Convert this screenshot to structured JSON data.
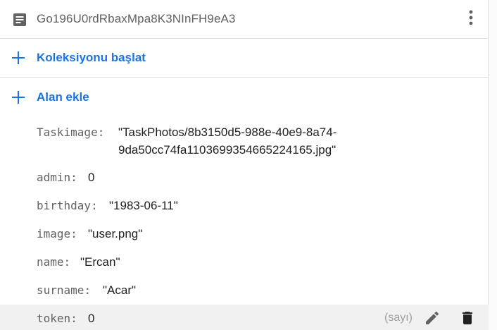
{
  "document": {
    "id": "Go196U0rdRbaxMpa8K3NInFH9eA3",
    "icons": {
      "doc": "document-icon",
      "more": "more-vert-icon"
    }
  },
  "actions": {
    "start_collection": "Koleksiyonu başlat",
    "add_field": "Alan ekle",
    "accent_color": "#1a73e8"
  },
  "fields": [
    {
      "key": "Taskimage",
      "value": "\"TaskPhotos/8b3150d5-988e-40e9-8a74-9da50cc74fa1103699354665224165.jpg\""
    },
    {
      "key": "admin",
      "value": "0"
    },
    {
      "key": "birthday",
      "value": "\"1983-06-11\""
    },
    {
      "key": "image",
      "value": "\"user.png\""
    },
    {
      "key": "name",
      "value": "\"Ercan\""
    },
    {
      "key": "surname",
      "value": "\"Acar\""
    },
    {
      "key": "token",
      "value": "0",
      "type_hint": "(sayı)"
    }
  ]
}
